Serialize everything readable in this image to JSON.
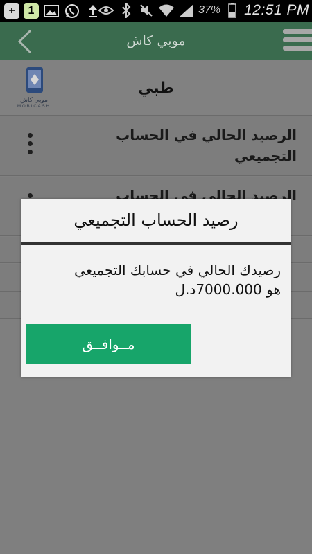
{
  "status_bar": {
    "notif_badge": "1",
    "battery_percent": "37%",
    "time": "12:51 PM",
    "icons": [
      "add-icon",
      "notification-one-icon",
      "gallery-icon",
      "whatsapp-icon",
      "upload-icon",
      "eye-icon",
      "bluetooth-icon",
      "mute-icon",
      "wifi-icon",
      "signal-icon",
      "battery-icon"
    ]
  },
  "app": {
    "title": "موبي كاش",
    "section_title": "طبي",
    "logo": {
      "arabic": "موبي كاش",
      "latin": "MOBICASH"
    },
    "colors": {
      "action_bar": "#3a6b4e",
      "accent": "#17a56a"
    }
  },
  "list": {
    "items": [
      {
        "label": "الرصيد الحالي في الحساب التجميعي"
      },
      {
        "label": "الرصيد الحالي في الحساب"
      }
    ]
  },
  "dialog": {
    "title": "رصيد الحساب التجميعي",
    "message_line1": "رصيدك الحالي في حسابك التجميعي",
    "message_line2": "هو 7000.000د.ل",
    "ok_label": "مــوافــق"
  }
}
